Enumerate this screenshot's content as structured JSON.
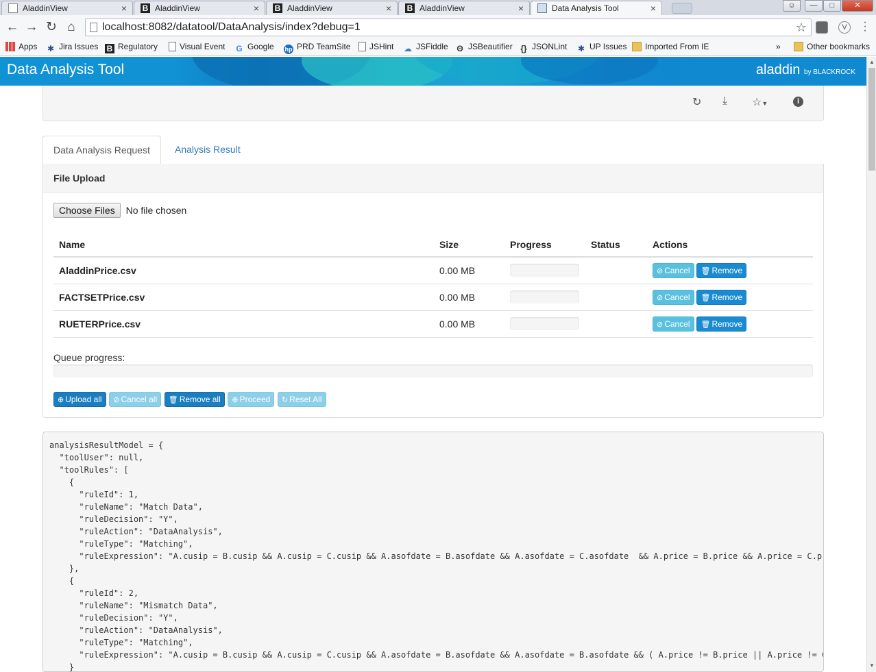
{
  "browser": {
    "tabs": [
      {
        "title": "AladdinView",
        "icon": "page-icon"
      },
      {
        "title": "AladdinView",
        "icon": "b-logo-icon"
      },
      {
        "title": "AladdinView",
        "icon": "b-logo-icon"
      },
      {
        "title": "AladdinView",
        "icon": "b-logo-icon"
      },
      {
        "title": "Data Analysis Tool",
        "icon": "image-icon",
        "active": true
      }
    ],
    "url": "localhost:8082/datatool/DataAnalysis/index?debug=1",
    "bookmarks": [
      "Apps",
      "Jira Issues",
      "Regulatory",
      "Visual Event",
      "Google",
      "PRD TeamSite",
      "JSHint",
      "JSFiddle",
      "JSBeautifier",
      "JSONLint",
      "UP Issues",
      "Imported From IE"
    ],
    "bookmark_overflow": "»",
    "other_bookmarks": "Other bookmarks"
  },
  "header": {
    "title": "Data Analysis Tool",
    "brand": "aladdin",
    "brand_suffix": "by BLACKROCK",
    "accent": "#1192d4"
  },
  "toolbar_icons": [
    "refresh-icon",
    "download-icon",
    "star-dropdown-icon",
    "info-icon"
  ],
  "tabs": {
    "request": "Data Analysis Request",
    "result": "Analysis Result"
  },
  "panel": {
    "heading": "File Upload",
    "choose_files": "Choose Files",
    "no_file": "No file chosen",
    "columns": {
      "name": "Name",
      "size": "Size",
      "progress": "Progress",
      "status": "Status",
      "actions": "Actions"
    },
    "files": [
      {
        "name": "AladdinPrice.csv",
        "size": "0.00 MB",
        "progress": 0,
        "status": ""
      },
      {
        "name": "FACTSETPrice.csv",
        "size": "0.00 MB",
        "progress": 0,
        "status": ""
      },
      {
        "name": "RUETERPrice.csv",
        "size": "0.00 MB",
        "progress": 0,
        "status": ""
      }
    ],
    "row_cancel": "Cancel",
    "row_remove": "Remove",
    "queue_label": "Queue progress:",
    "queue_progress": 0,
    "buttons": {
      "upload_all": "Upload all",
      "cancel_all": "Cancel all",
      "remove_all": "Remove all",
      "proceed": "Proceed",
      "reset_all": "Reset All"
    }
  },
  "debug_lines": [
    "analysisResultModel = {",
    "  \"toolUser\": null,",
    "  \"toolRules\": [",
    "    {",
    "      \"ruleId\": 1,",
    "      \"ruleName\": \"Match Data\",",
    "      \"ruleDecision\": \"Y\",",
    "      \"ruleAction\": \"DataAnalysis\",",
    "      \"ruleType\": \"Matching\",",
    "      \"ruleExpression\": \"A.cusip = B.cusip && A.cusip = C.cusip && A.asofdate = B.asofdate && A.asofdate = C.asofdate  && A.price = B.price && A.price = C.pri",
    "    },",
    "    {",
    "      \"ruleId\": 2,",
    "      \"ruleName\": \"Mismatch Data\",",
    "      \"ruleDecision\": \"Y\",",
    "      \"ruleAction\": \"DataAnalysis\",",
    "      \"ruleType\": \"Matching\",",
    "      \"ruleExpression\": \"A.cusip = B.cusip && A.cusip = C.cusip && A.asofdate = B.asofdate && A.asofdate = B.asofdate && ( A.price != B.price || A.price != C.",
    "    }"
  ]
}
